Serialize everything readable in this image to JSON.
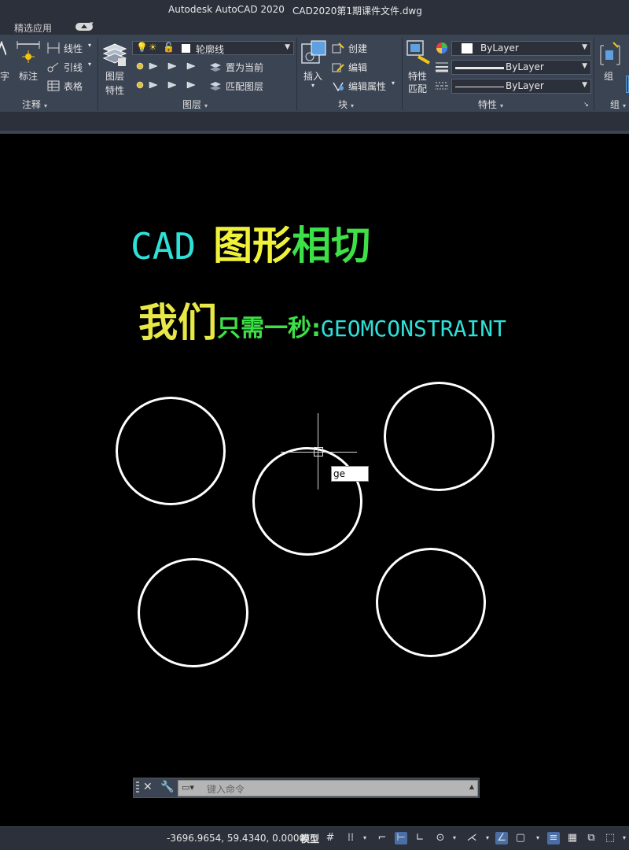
{
  "titlebar": {
    "app": "Autodesk AutoCAD 2020",
    "file": "CAD2020第1期课件文件.dwg"
  },
  "tabrow": {
    "tab": "精选应用"
  },
  "ribbon": {
    "annotation": {
      "text_frag": "字",
      "dim": "标注",
      "linear": "线性",
      "leader": "引线",
      "table": "表格",
      "panel": "注释"
    },
    "layers": {
      "props": [
        "图层",
        "特性"
      ],
      "current_layer": "轮廓线",
      "set_current": "置为当前",
      "match_layer": "匹配图层",
      "panel": "图层"
    },
    "block": {
      "insert": "插入",
      "create": "创建",
      "edit": "编辑",
      "edit_attr": "编辑属性",
      "panel": "块"
    },
    "properties": {
      "match": [
        "特性",
        "匹配"
      ],
      "color": "ByLayer",
      "lineweight": "ByLayer",
      "linetype": "ByLayer",
      "panel": "特性"
    },
    "groups": {
      "group": "组",
      "panel": "组"
    }
  },
  "canvas": {
    "heading1": {
      "cad": "CAD",
      "cn_yellow": "图形",
      "cn_green": "相切"
    },
    "heading2": {
      "big": "我们",
      "mid": "只需一秒:",
      "cmd": "GEOMCONSTRAINT"
    },
    "dynamic_input": "ge"
  },
  "command_line": {
    "placeholder": "键入命令"
  },
  "statusbar": {
    "coords": "-3696.9654, 59.4340, 0.0000",
    "model": "模型"
  },
  "colors": {
    "cyan": "#2fe0d8",
    "yellow": "#f0f23a",
    "green": "#3ee047",
    "ribbon": "#3b4453",
    "titlebar": "#2b303b"
  }
}
